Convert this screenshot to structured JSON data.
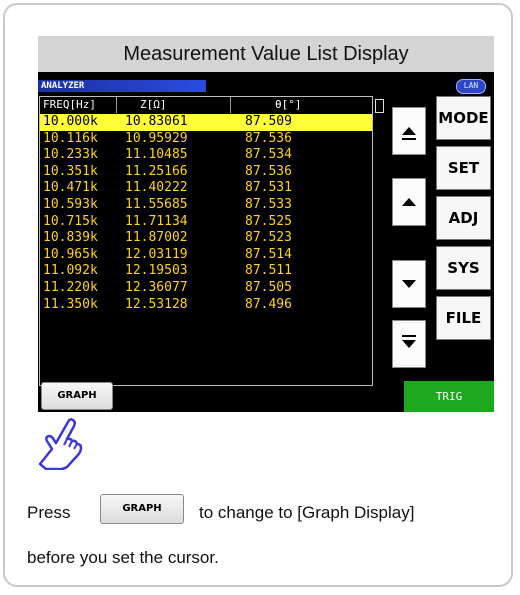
{
  "title": "Measurement Value List Display",
  "screen": {
    "mode_tab": "ANALYZER",
    "lan_badge": "LAN",
    "headers": {
      "freq": "FREQ[Hz]",
      "z": "Z[Ω]",
      "theta": "θ[°]"
    },
    "rows": [
      {
        "freq": "10.000k",
        "z": "10.83061",
        "theta": "87.509"
      },
      {
        "freq": "10.116k",
        "z": "10.95929",
        "theta": "87.536"
      },
      {
        "freq": "10.233k",
        "z": "11.10485",
        "theta": "87.534"
      },
      {
        "freq": "10.351k",
        "z": "11.25166",
        "theta": "87.536"
      },
      {
        "freq": "10.471k",
        "z": "11.40222",
        "theta": "87.531"
      },
      {
        "freq": "10.593k",
        "z": "11.55685",
        "theta": "87.533"
      },
      {
        "freq": "10.715k",
        "z": "11.71134",
        "theta": "87.525"
      },
      {
        "freq": "10.839k",
        "z": "11.87002",
        "theta": "87.523"
      },
      {
        "freq": "10.965k",
        "z": "12.03119",
        "theta": "87.514"
      },
      {
        "freq": "11.092k",
        "z": "12.19503",
        "theta": "87.511"
      },
      {
        "freq": "11.220k",
        "z": "12.36077",
        "theta": "87.505"
      },
      {
        "freq": "11.350k",
        "z": "12.53128",
        "theta": "87.496"
      }
    ],
    "selected_row": 0,
    "side_buttons": [
      "MODE",
      "SET",
      "ADJ",
      "SYS",
      "FILE"
    ],
    "graph_button": "GRAPH",
    "trig_button": "TRIG",
    "colors": {
      "row_text": "#ffd21f",
      "selected_bg": "#ffff3a",
      "trig_bg": "#1ea81e"
    }
  },
  "instruction": {
    "before": "Press",
    "button": "GRAPH",
    "after": "to change to [Graph Display]",
    "line2": "before you set the cursor."
  },
  "icons": {
    "pointer": "pointing-hand-icon"
  }
}
